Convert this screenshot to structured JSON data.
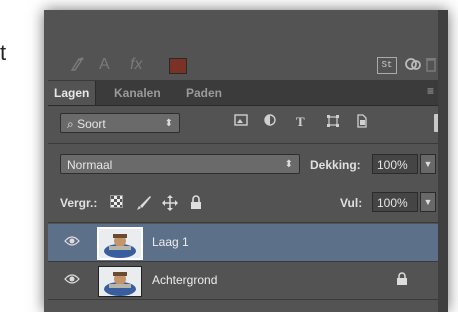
{
  "lead_text": "t",
  "toolbar": {
    "icons": [
      "brush-icon",
      "text-icon",
      "fx-icon",
      "color-swatch",
      "st-icon",
      "link-icon",
      "trash-icon"
    ],
    "text_icon": "A",
    "fx_icon": "fx",
    "st_label": "St",
    "swatch_color": "#7a3226"
  },
  "tabs": [
    {
      "label": "Lagen",
      "active": true
    },
    {
      "label": "Kanalen",
      "active": false
    },
    {
      "label": "Paden",
      "active": false
    }
  ],
  "filter": {
    "kind_label": "Soort",
    "icon_type_t": "T"
  },
  "blend": {
    "mode": "Normaal",
    "opacity_label": "Dekking:",
    "opacity_value": "100%"
  },
  "lock": {
    "label": "Vergr.:",
    "fill_label": "Vul:",
    "fill_value": "100%"
  },
  "layers": [
    {
      "name": "Laag 1",
      "selected": true,
      "locked": false
    },
    {
      "name": "Achtergrond",
      "selected": false,
      "locked": true
    }
  ],
  "colors": {
    "panel_bg": "#535353",
    "selected_row": "#5d7089"
  }
}
